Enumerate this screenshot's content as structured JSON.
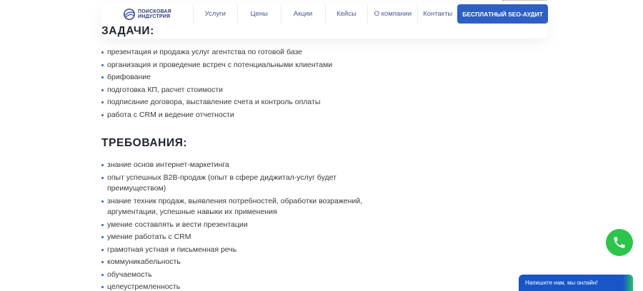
{
  "header": {
    "logo_line1": "Поисковая",
    "logo_line2": "индустрия",
    "nav": [
      "Услуги",
      "Цены",
      "Акции",
      "Кейсы",
      "О компании",
      "Контакты"
    ],
    "cta": "Бесплатный SEO-аудит"
  },
  "tasks": {
    "title": "ЗАДАЧИ:",
    "items": [
      "презентация и продажа услуг агентства по готовой базе",
      "организация и проведение встреч с потенциальными клиентами",
      "брифование",
      "подготовка КП, расчет стоимости",
      "подписание договора, выставление счета и контроль оплаты",
      "работа с CRM и ведение отчетности"
    ]
  },
  "requirements": {
    "title": "ТРЕБОВАНИЯ:",
    "items": [
      "знание основ интернет-маркетинга",
      "опыт успешных B2B-продаж (опыт в сфере диджитал-услуг будет",
      "преимуществом)",
      "знание техник продаж, выявления потребностей, обработки возражений,",
      "аргументации, успешные навыки их применения",
      "умение составлять и вести презентации",
      "умение работать с CRM",
      "грамотная устная и письменная речь",
      "коммуникабельность",
      "обучаемость",
      "целеустремленность"
    ]
  },
  "widgets": {
    "chat_label": "Напишите нам, мы онлайн!",
    "call_icon": "phone-icon"
  },
  "colors": {
    "accent": "#2f5fc4",
    "call": "#2cc44b",
    "chat": "#1856c6"
  }
}
